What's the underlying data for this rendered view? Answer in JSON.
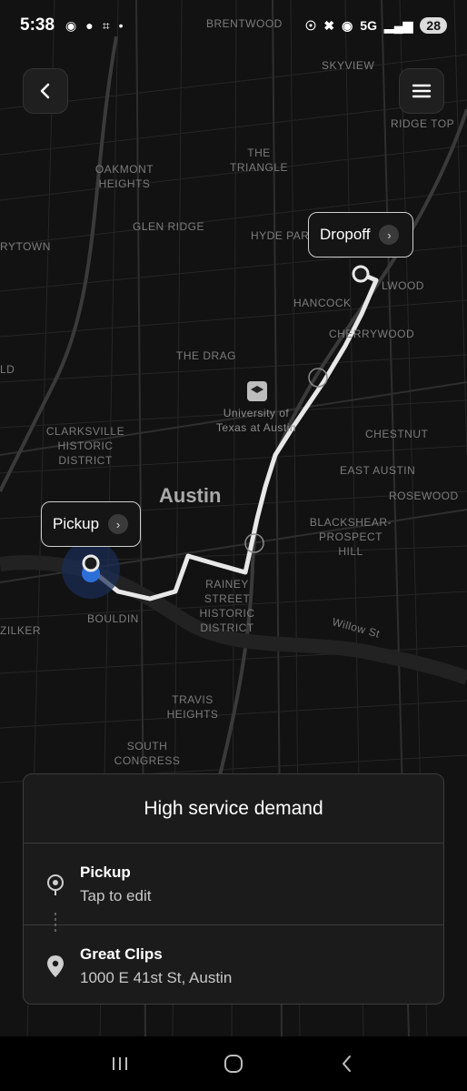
{
  "status_bar": {
    "time": "5:38",
    "network": "5G",
    "battery": "28",
    "left_icons": [
      "location-icon",
      "chat-icon",
      "screenshot-icon",
      "dot-icon"
    ],
    "right_icons": [
      "key-icon",
      "mute-icon",
      "location-icon",
      "signal-icon"
    ]
  },
  "map": {
    "city": "Austin",
    "neighborhoods": [
      "BRENTWOOD",
      "SKYVIEW",
      "RIDGE TOP",
      "OAKMONT HEIGHTS",
      "THE TRIANGLE",
      "GLEN RIDGE",
      "HYDE PARK",
      "RYTOWN",
      "HANCOCK",
      "LWOOD",
      "CHERRYWOOD",
      "THE DRAG",
      "LD",
      "University of Texas at Austin",
      "CLARKSVILLE HISTORIC DISTRICT",
      "CHESTNUT",
      "EAST AUSTIN",
      "ROSEWOOD",
      "BLACKSHEAR-PROSPECT HILL",
      "RAINEY STREET HISTORIC DISTRICT",
      "BOULDIN",
      "ZILKER",
      "Willow St",
      "TRAVIS HEIGHTS",
      "SOUTH CONGRESS"
    ],
    "pickup_callout": "Pickup",
    "dropoff_callout": "Dropoff"
  },
  "sheet": {
    "title": "High service demand",
    "pickup": {
      "label": "Pickup",
      "sub": "Tap to edit"
    },
    "destination": {
      "label": "Great Clips",
      "address": "1000 E 41st St, Austin"
    }
  },
  "colors": {
    "map_bg": "#121212",
    "route": "#e8e8e8",
    "user_dot": "#2d6fd9"
  }
}
